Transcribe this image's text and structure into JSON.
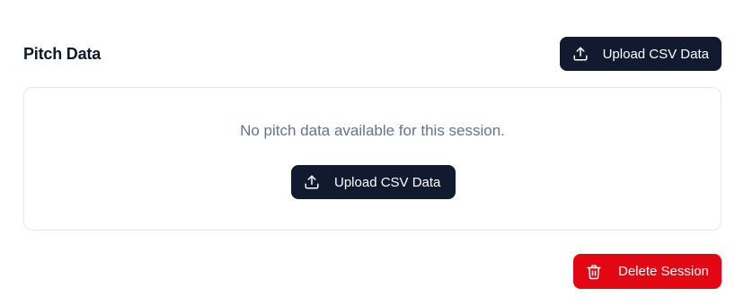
{
  "section": {
    "title": "Pitch Data",
    "upload_label": "Upload CSV Data"
  },
  "empty_state": {
    "message": "No pitch data available for this session.",
    "upload_label": "Upload CSV Data"
  },
  "actions": {
    "delete_label": "Delete Session"
  },
  "colors": {
    "primary_button": "#111a2e",
    "danger_button": "#e30613",
    "muted_text": "#64748b",
    "card_border": "#e3e7ee"
  },
  "icons": {
    "upload": "upload-icon",
    "delete": "trash-icon"
  }
}
